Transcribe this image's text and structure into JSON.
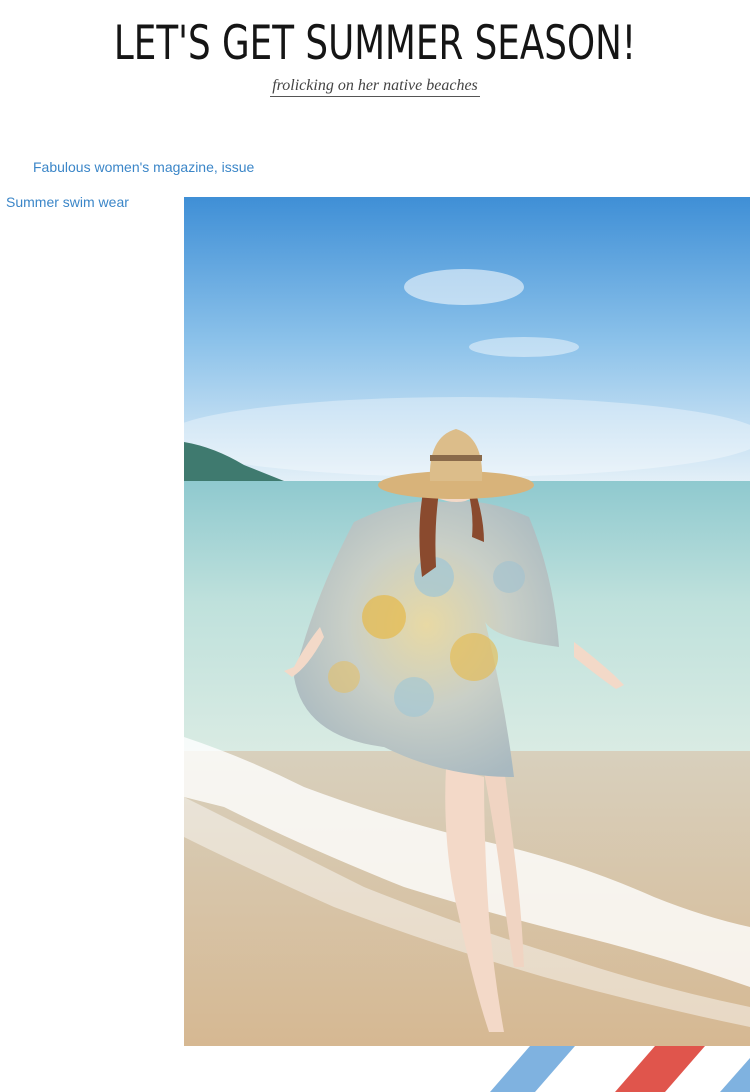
{
  "header": {
    "headline": "LET'S GET SUMMER SEASON!",
    "subhead": "frolicking on her native beaches"
  },
  "captions": {
    "magazine": "Fabulous women's magazine, issue",
    "category": "Summer swim wear"
  },
  "colors": {
    "caption": "#3b86c8",
    "stripe_blue": "#7fb2e0",
    "stripe_red": "#e0554c"
  }
}
